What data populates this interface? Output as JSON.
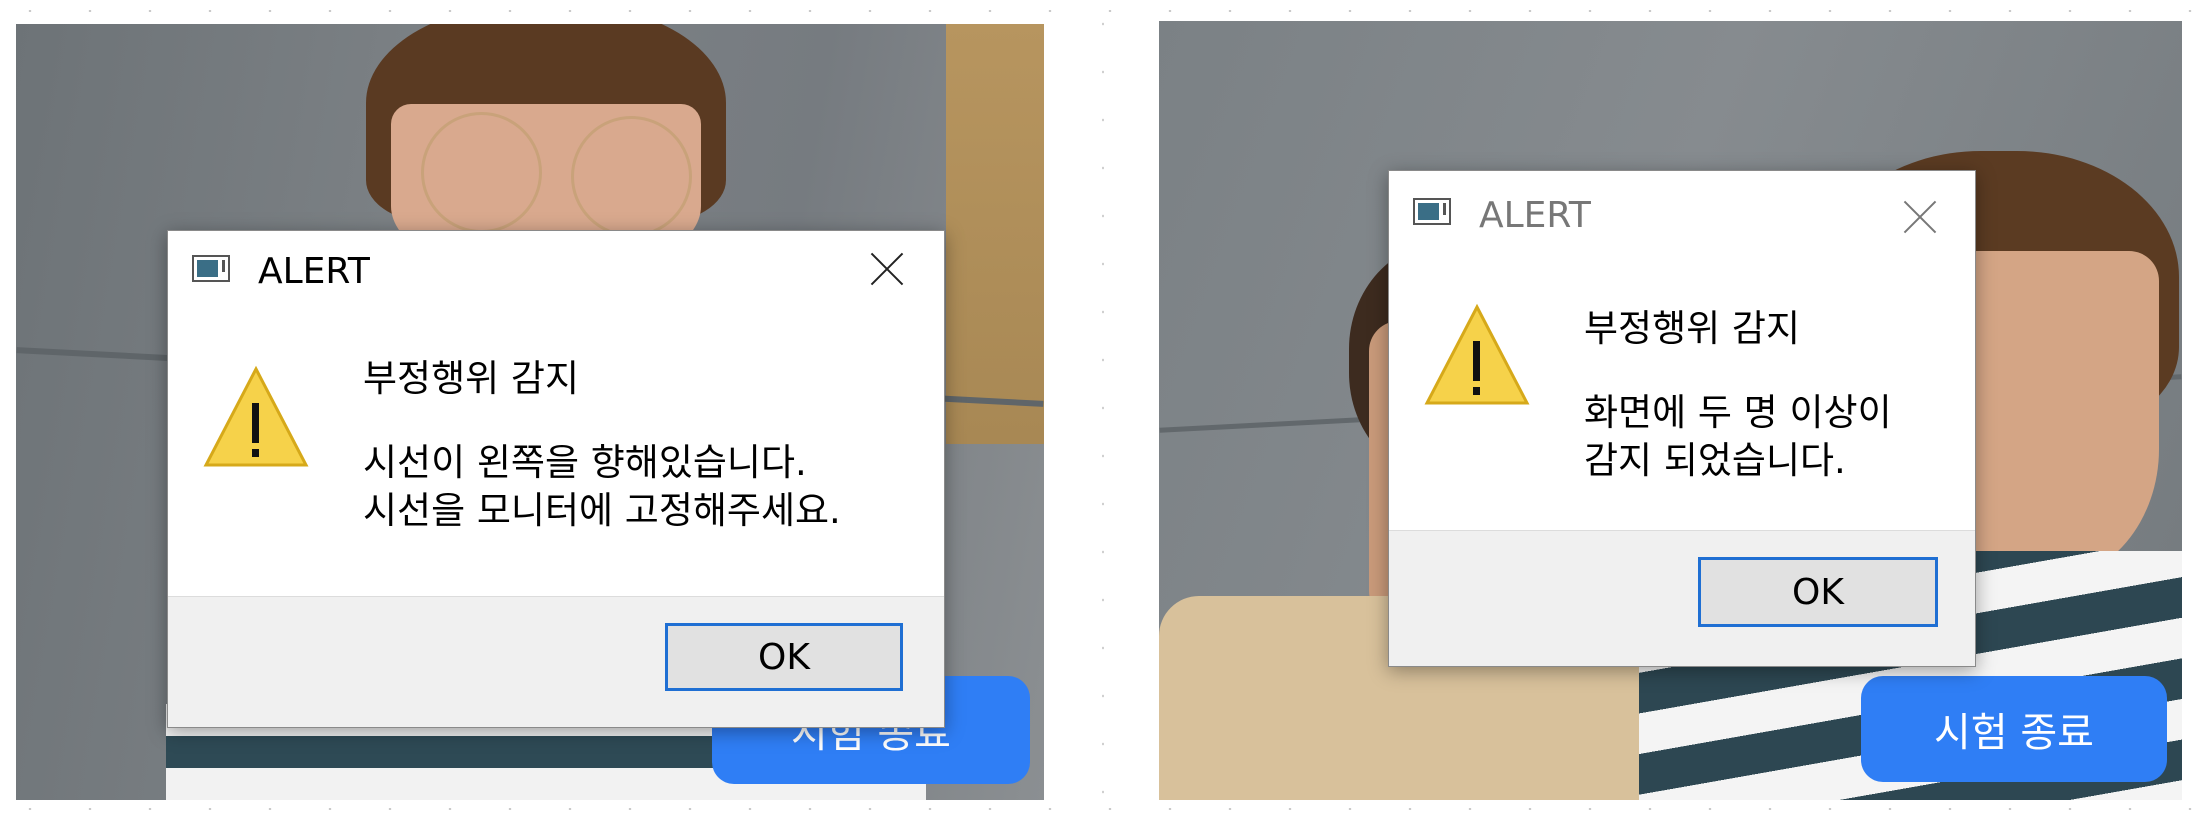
{
  "left_panel": {
    "dialog": {
      "title": "ALERT",
      "heading": "부정행위 감지",
      "line1": "시선이 왼쪽을 향해있습니다.",
      "line2": "시선을 모니터에 고정해주세요.",
      "ok_label": "OK",
      "icon": "warning-icon"
    },
    "exam_end_label": "시험 종료"
  },
  "right_panel": {
    "dialog": {
      "title": "ALERT",
      "heading": "부정행위 감지",
      "line1": "화면에 두 명 이상이",
      "line2": "감지 되었습니다.",
      "ok_label": "OK",
      "icon": "warning-icon"
    },
    "exam_end_label": "시험 종료"
  },
  "colors": {
    "accent_button": "#2f7ef5",
    "ok_focus_border": "#1f6fd3",
    "warning_fill": "#f6d24a"
  }
}
